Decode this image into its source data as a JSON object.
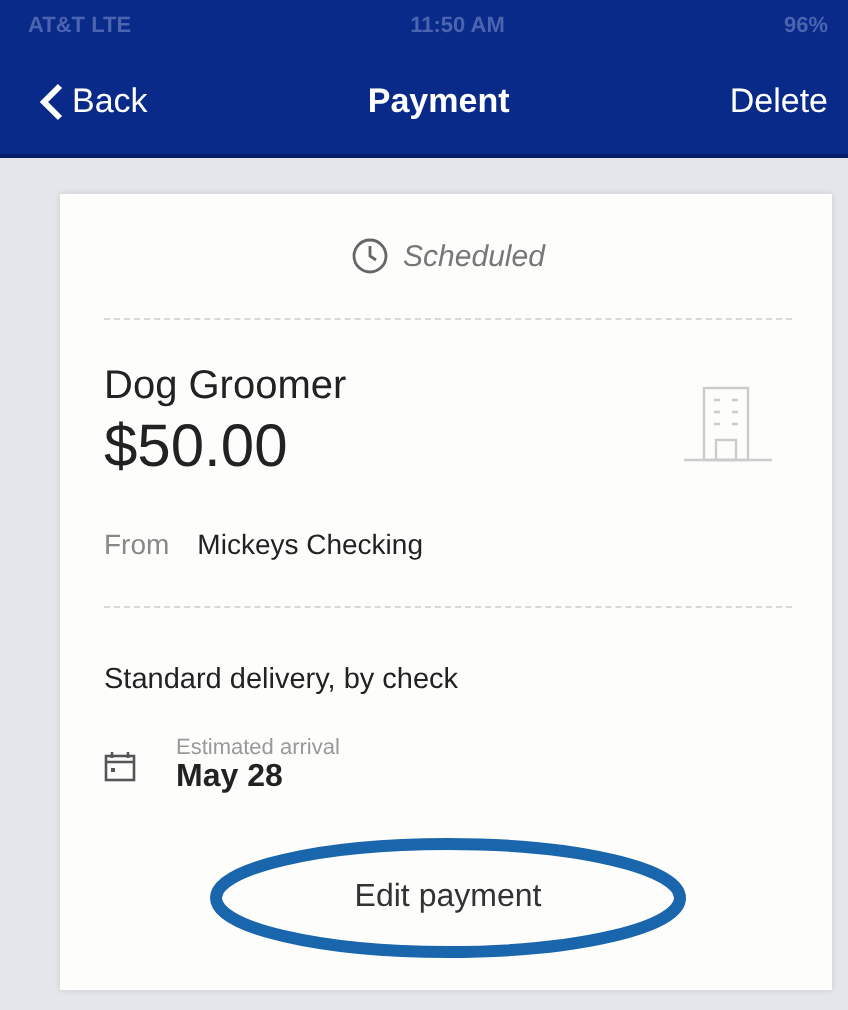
{
  "status_bar": {
    "carrier": "AT&T  LTE",
    "time": "11:50 AM",
    "battery": "96%"
  },
  "nav": {
    "back": "Back",
    "title": "Payment",
    "action": "Delete"
  },
  "payment": {
    "status": "Scheduled",
    "payee": "Dog Groomer",
    "amount": "$50.00",
    "from_label": "From",
    "from_account": "Mickeys Checking",
    "delivery": "Standard delivery, by check",
    "arrival_label": "Estimated arrival",
    "arrival_date": "May 28",
    "edit_button": "Edit payment",
    "edit_circled": true
  }
}
